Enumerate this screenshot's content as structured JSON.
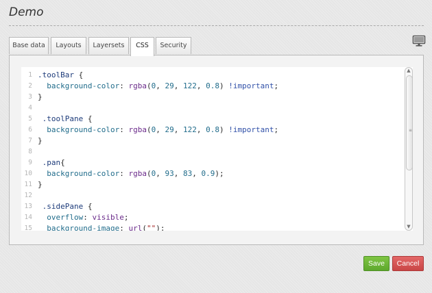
{
  "page": {
    "title": "Demo"
  },
  "tabs": [
    {
      "label": "Base data",
      "active": false
    },
    {
      "label": "Layouts",
      "active": false
    },
    {
      "label": "Layersets",
      "active": false
    },
    {
      "label": "CSS",
      "active": true
    },
    {
      "label": "Security",
      "active": false
    }
  ],
  "toolbar": {
    "monitor_icon": "monitor-icon"
  },
  "editor": {
    "lines": [
      {
        "n": "1",
        "parts": [
          [
            "sel",
            ".toolBar"
          ],
          [
            "p",
            " {"
          ]
        ]
      },
      {
        "n": "2",
        "parts": [
          [
            "p",
            "  "
          ],
          [
            "prop",
            "background-color"
          ],
          [
            "p",
            ": "
          ],
          [
            "val",
            "rgba"
          ],
          [
            "p",
            "("
          ],
          [
            "num",
            "0"
          ],
          [
            "p",
            ", "
          ],
          [
            "num",
            "29"
          ],
          [
            "p",
            ", "
          ],
          [
            "num",
            "122"
          ],
          [
            "p",
            ", "
          ],
          [
            "num",
            "0.8"
          ],
          [
            "p",
            ") "
          ],
          [
            "imp",
            "!important"
          ],
          [
            "p",
            ";"
          ]
        ]
      },
      {
        "n": "3",
        "parts": [
          [
            "p",
            "}"
          ]
        ]
      },
      {
        "n": "4",
        "parts": []
      },
      {
        "n": "5",
        "parts": [
          [
            "sel",
            " .toolPane"
          ],
          [
            "p",
            " {"
          ]
        ]
      },
      {
        "n": "6",
        "parts": [
          [
            "p",
            "  "
          ],
          [
            "prop",
            "background-color"
          ],
          [
            "p",
            ": "
          ],
          [
            "val",
            "rgba"
          ],
          [
            "p",
            "("
          ],
          [
            "num",
            "0"
          ],
          [
            "p",
            ", "
          ],
          [
            "num",
            "29"
          ],
          [
            "p",
            ", "
          ],
          [
            "num",
            "122"
          ],
          [
            "p",
            ", "
          ],
          [
            "num",
            "0.8"
          ],
          [
            "p",
            ") "
          ],
          [
            "imp",
            "!important"
          ],
          [
            "p",
            ";"
          ]
        ]
      },
      {
        "n": "7",
        "parts": [
          [
            "p",
            "}"
          ]
        ]
      },
      {
        "n": "8",
        "parts": []
      },
      {
        "n": "9",
        "parts": [
          [
            "sel",
            " .pan"
          ],
          [
            "p",
            "{"
          ]
        ]
      },
      {
        "n": "10",
        "parts": [
          [
            "p",
            "  "
          ],
          [
            "prop",
            "background-color"
          ],
          [
            "p",
            ": "
          ],
          [
            "val",
            "rgba"
          ],
          [
            "p",
            "("
          ],
          [
            "num",
            "0"
          ],
          [
            "p",
            ", "
          ],
          [
            "num",
            "93"
          ],
          [
            "p",
            ", "
          ],
          [
            "num",
            "83"
          ],
          [
            "p",
            ", "
          ],
          [
            "num",
            "0.9"
          ],
          [
            "p",
            ");"
          ]
        ]
      },
      {
        "n": "11",
        "parts": [
          [
            "p",
            "}"
          ]
        ]
      },
      {
        "n": "12",
        "parts": []
      },
      {
        "n": "13",
        "parts": [
          [
            "sel",
            " .sidePane"
          ],
          [
            "p",
            " {"
          ]
        ]
      },
      {
        "n": "14",
        "parts": [
          [
            "p",
            "  "
          ],
          [
            "prop",
            "overflow"
          ],
          [
            "p",
            ": "
          ],
          [
            "val",
            "visible"
          ],
          [
            "p",
            ";"
          ]
        ]
      },
      {
        "n": "15",
        "parts": [
          [
            "p",
            "  "
          ],
          [
            "prop",
            "background-image"
          ],
          [
            "p",
            ": "
          ],
          [
            "val",
            "url"
          ],
          [
            "p",
            "("
          ],
          [
            "str",
            "\"\""
          ],
          [
            "p",
            ");"
          ]
        ]
      }
    ]
  },
  "scrollbar": {
    "up_icon": "▲",
    "down_icon": "▼",
    "grip_icon": "≡",
    "position": 0.0
  },
  "actions": {
    "save_label": "Save",
    "cancel_label": "Cancel"
  },
  "colors": {
    "save": "#6cb33a",
    "cancel": "#d25656",
    "background": "#e6e6e6"
  }
}
